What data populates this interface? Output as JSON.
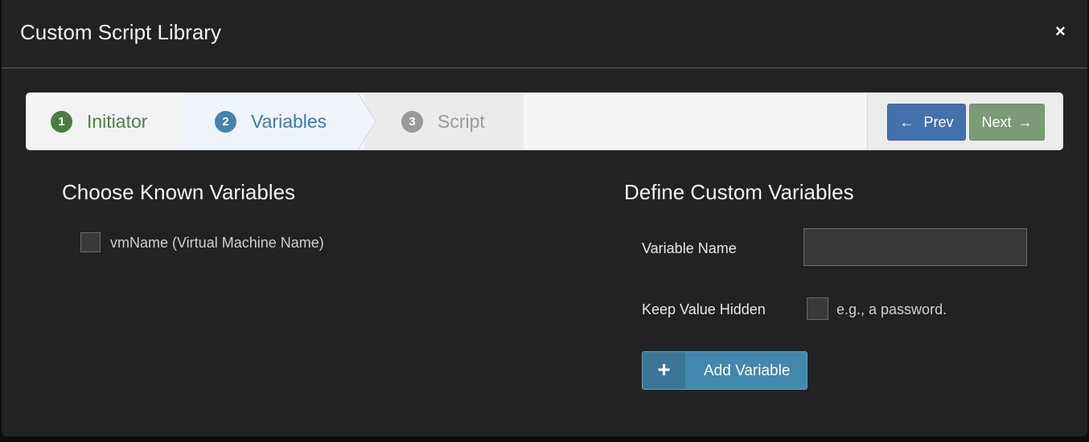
{
  "modal": {
    "title": "Custom Script Library",
    "close_icon": "×"
  },
  "wizard": {
    "steps": [
      {
        "number": "1",
        "label": "Initiator",
        "state": "completed",
        "color": "#4b7d41"
      },
      {
        "number": "2",
        "label": "Variables",
        "state": "active",
        "color": "#4584ad"
      },
      {
        "number": "3",
        "label": "Script",
        "state": "pending",
        "color": "#9a9a9a"
      }
    ],
    "prev_label": "Prev",
    "prev_icon": "←",
    "next_label": "Next",
    "next_icon": "→"
  },
  "known_variables": {
    "title": "Choose Known Variables",
    "items": [
      {
        "label": "vmName (Virtual Machine Name)",
        "checked": false
      }
    ]
  },
  "custom_variables": {
    "title": "Define Custom Variables",
    "variable_name_label": "Variable Name",
    "variable_name_value": "",
    "keep_hidden_label": "Keep Value Hidden",
    "keep_hidden_checked": false,
    "keep_hidden_hint": "e.g., a password.",
    "add_button_icon": "+",
    "add_button_label": "Add Variable"
  }
}
